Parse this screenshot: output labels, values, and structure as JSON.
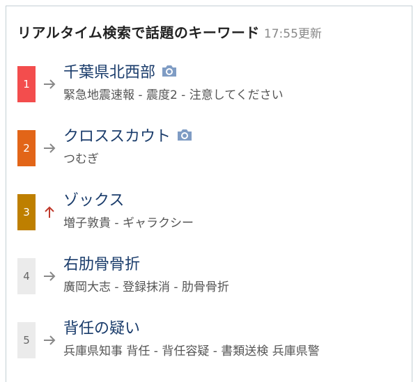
{
  "header": {
    "title": "リアルタイム検索で話題のキーワード",
    "time": "17:55更新"
  },
  "colors": {
    "rank1": "#f34d4d",
    "rank2": "#e26518",
    "rank3": "#be7f00",
    "rank_other": "#ebebeb",
    "keyword": "#1a3c6b",
    "trend_up": "#c0392b",
    "trend_flat": "#888888",
    "camera_icon": "#7f9cc4"
  },
  "items": [
    {
      "rank": "1",
      "keyword": "千葉県北西部",
      "sub": "緊急地震速報 - 震度2 - 注意してください",
      "trend": "arrow-right-icon",
      "has_camera": true
    },
    {
      "rank": "2",
      "keyword": "クロススカウト",
      "sub": "つむぎ",
      "trend": "arrow-right-icon",
      "has_camera": true
    },
    {
      "rank": "3",
      "keyword": "ゾックス",
      "sub": "増子敦貴 - ギャラクシー",
      "trend": "arrow-up-icon",
      "has_camera": false
    },
    {
      "rank": "4",
      "keyword": "右肋骨骨折",
      "sub": "廣岡大志 - 登録抹消 - 肋骨骨折",
      "trend": "arrow-right-icon",
      "has_camera": false
    },
    {
      "rank": "5",
      "keyword": "背任の疑い",
      "sub": "兵庫県知事 背任 - 背任容疑 - 書類送検 兵庫県警",
      "trend": "arrow-right-icon",
      "has_camera": false
    }
  ]
}
